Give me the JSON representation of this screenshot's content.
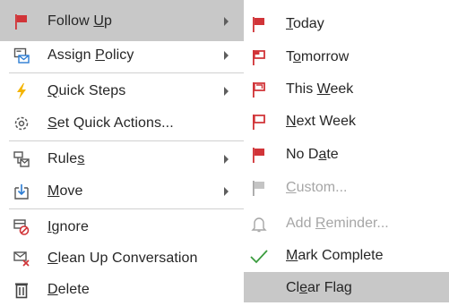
{
  "context_menu": {
    "items": [
      {
        "pre": "Follow ",
        "ul": "U",
        "post": "p",
        "icon": "red-flag-icon",
        "has_submenu": true
      },
      {
        "pre": "Assign ",
        "ul": "P",
        "post": "olicy",
        "icon": "assign-policy-icon",
        "has_submenu": true
      },
      {
        "pre": "",
        "ul": "Q",
        "post": "uick Steps",
        "icon": "lightning-icon",
        "has_submenu": true
      },
      {
        "pre": "",
        "ul": "S",
        "post": "et Quick Actions...",
        "icon": "gear-icon",
        "has_submenu": false
      },
      {
        "pre": "Rule",
        "ul": "s",
        "post": "",
        "icon": "rules-icon",
        "has_submenu": true
      },
      {
        "pre": "",
        "ul": "M",
        "post": "ove",
        "icon": "move-icon",
        "has_submenu": true
      },
      {
        "pre": "",
        "ul": "I",
        "post": "gnore",
        "icon": "ignore-icon",
        "has_submenu": false
      },
      {
        "pre": "",
        "ul": "C",
        "post": "lean Up Conversation",
        "icon": "clean-up-icon",
        "has_submenu": false
      },
      {
        "pre": "",
        "ul": "D",
        "post": "elete",
        "icon": "trash-icon",
        "has_submenu": false
      }
    ]
  },
  "follow_up_submenu": {
    "items": [
      {
        "pre": "",
        "ul": "T",
        "post": "oday",
        "icon": "red-flag-icon"
      },
      {
        "pre": "T",
        "ul": "o",
        "post": "morrow",
        "icon": "red-flag-icon"
      },
      {
        "pre": "This ",
        "ul": "W",
        "post": "eek",
        "icon": "red-flag-icon"
      },
      {
        "pre": "",
        "ul": "N",
        "post": "ext Week",
        "icon": "red-flag-icon"
      },
      {
        "pre": "No D",
        "ul": "a",
        "post": "te",
        "icon": "red-flag-icon"
      },
      {
        "pre": "",
        "ul": "C",
        "post": "ustom...",
        "icon": "gray-flag-icon",
        "disabled": true
      },
      {
        "pre": "Add ",
        "ul": "R",
        "post": "eminder...",
        "icon": "bell-icon",
        "disabled": true
      },
      {
        "pre": "",
        "ul": "M",
        "post": "ark Complete",
        "icon": "checkmark-icon"
      },
      {
        "pre": "Cl",
        "ul": "e",
        "post": "ar Flag",
        "icon": "none"
      }
    ]
  },
  "colors": {
    "flag_red": "#d13438",
    "highlight": "#c8c8c8",
    "check_green": "#3a9c3e",
    "icon_blue": "#2b7cd3"
  }
}
